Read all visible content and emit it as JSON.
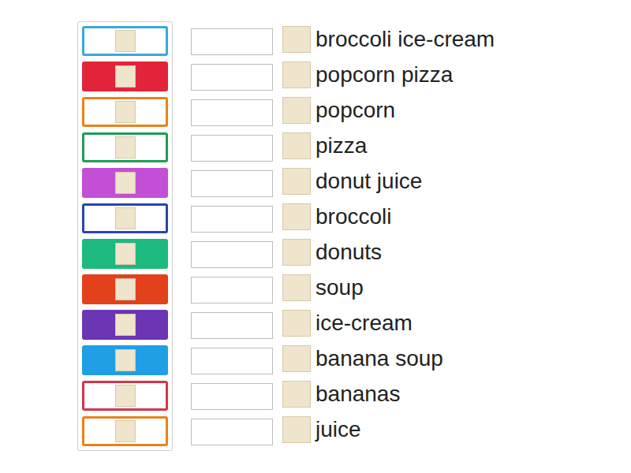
{
  "activity": {
    "type": "match-up"
  },
  "tiles": [
    {
      "kind": "outline",
      "color": "#3aa7dd"
    },
    {
      "kind": "filled",
      "color": "#e2243b"
    },
    {
      "kind": "outline",
      "color": "#e9821b"
    },
    {
      "kind": "outline",
      "color": "#1d9d55"
    },
    {
      "kind": "filled",
      "color": "#c24fd5"
    },
    {
      "kind": "outline",
      "color": "#2b45ae"
    },
    {
      "kind": "filled",
      "color": "#1eb97f"
    },
    {
      "kind": "filled",
      "color": "#e2411b"
    },
    {
      "kind": "filled",
      "color": "#6b36b4"
    },
    {
      "kind": "filled",
      "color": "#209fe6"
    },
    {
      "kind": "outline",
      "color": "#d8344a"
    },
    {
      "kind": "outline",
      "color": "#e9821b"
    }
  ],
  "answer_slots": [
    {
      "filled": false
    },
    {
      "filled": false
    },
    {
      "filled": false
    },
    {
      "filled": false
    },
    {
      "filled": false
    },
    {
      "filled": false
    },
    {
      "filled": false
    },
    {
      "filled": false
    },
    {
      "filled": false
    },
    {
      "filled": false
    },
    {
      "filled": false
    },
    {
      "filled": false
    }
  ],
  "labels": [
    {
      "text": "broccoli ice-cream"
    },
    {
      "text": "popcorn pizza"
    },
    {
      "text": "popcorn"
    },
    {
      "text": "pizza"
    },
    {
      "text": "donut juice"
    },
    {
      "text": "broccoli"
    },
    {
      "text": "donuts"
    },
    {
      "text": "soup"
    },
    {
      "text": "ice-cream"
    },
    {
      "text": "banana soup"
    },
    {
      "text": "bananas"
    },
    {
      "text": "juice"
    }
  ]
}
